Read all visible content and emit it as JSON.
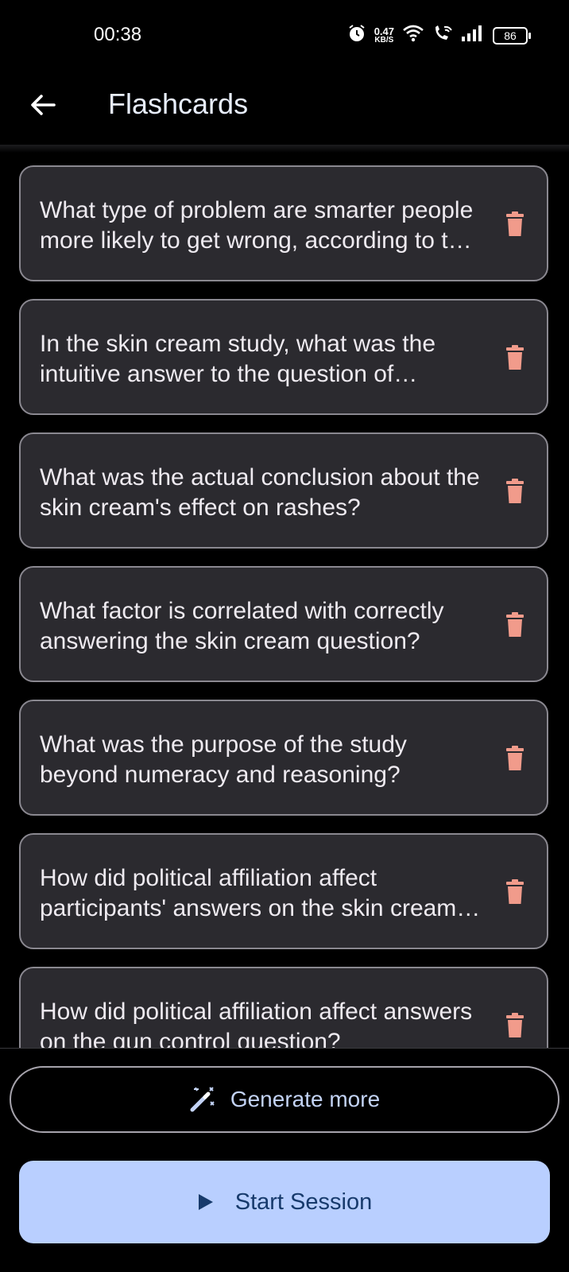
{
  "status_bar": {
    "time": "00:38",
    "net_speed_value": "0.47",
    "net_speed_unit": "KB/S",
    "battery": "86",
    "icons": [
      "alarm-icon",
      "wifi-icon",
      "wifi-calling-icon",
      "signal-icon",
      "battery-icon"
    ]
  },
  "header": {
    "title": "Flashcards",
    "back_icon": "arrow-back-icon"
  },
  "cards": [
    {
      "question": "What type of problem are smarter people more likely to get wrong, according to the study?"
    },
    {
      "question": "In the skin cream study, what was the intuitive answer to the question of whether the cream worked?"
    },
    {
      "question": "What was the actual conclusion about the skin cream's effect on rashes?"
    },
    {
      "question": "What factor is correlated with correctly answering the skin cream question?"
    },
    {
      "question": "What was the purpose of the study beyond numeracy and reasoning?"
    },
    {
      "question": "How did political affiliation affect participants' answers on the skin cream question?"
    },
    {
      "question": "How did political affiliation affect answers on the gun control question?"
    }
  ],
  "actions": {
    "generate_label": "Generate more",
    "generate_icon": "magic-wand-icon",
    "start_label": "Start Session",
    "start_icon": "play-icon"
  },
  "colors": {
    "background": "#000000",
    "card_background": "#2b2a2f",
    "delete_icon": "#f19b8b",
    "accent": "#b9cfff",
    "accent_text": "#173a6c"
  }
}
